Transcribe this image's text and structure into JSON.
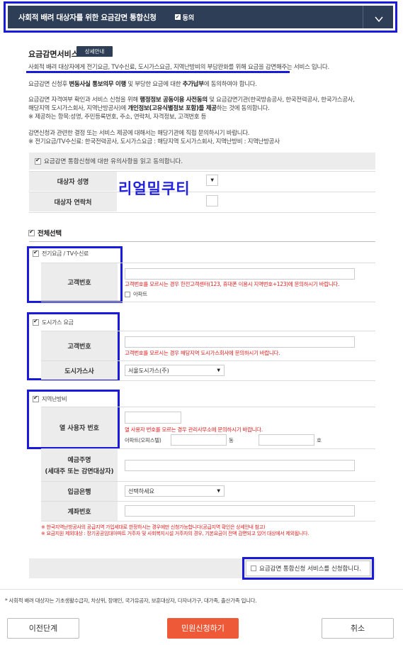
{
  "header": {
    "title": "사회적 배려 대상자를 위한 요금감면 통합신청",
    "agree_label": "동의"
  },
  "service": {
    "title": "요금감면서비스",
    "detail_button": "상세안내",
    "desc1": "사회적 배려 대상자에게 전기요금, TV수신료, 도시가스요금, 지역난방비의 부담완화를 위해 요금을 감면해주는 서비스 입니다.",
    "desc2_pre": "요금감면 신청후 ",
    "desc2_b1": "변동사실 통보의무 이행",
    "desc2_mid": " 및 부당한 요금에 대한 ",
    "desc2_b2": "추가납부",
    "desc2_post": "에 동의하여야 합니다.",
    "desc3_line1_pre": "요금감면 자격여부 확인과 서비스 신청을 위해 ",
    "desc3_line1_b": "행정정보 공동이용 사전동의",
    "desc3_line1_post": " 및 요금감면기관(한국방송공사, 한국전력공사, 한국가스공사,",
    "desc3_line2_pre": "해당지역 도시가스회사, 지역난방공사)에 ",
    "desc3_line2_b": "개인정보(고유식별정보 포함)를 제공",
    "desc3_line2_post": "하는 것에 동의합니다.",
    "desc3_line3": "※ 제공하는 항목:성명, 주민등록번호, 주소, 연락처, 자격정보, 고객번호 등",
    "desc4_line1": "감면신청과 관련한 결정 또는 서비스 제공에 대해서는 해당기관에 직접 문의하시기 바랍니다.",
    "desc4_line2": "※ 전기요금/TV수신료: 한국전력공사, 도시가스요금 : 해당지역 도시가스회사, 지역난방비 : 지역난방공사"
  },
  "consent": {
    "label": "요금감면 통합신청에 대한 유의사항을 읽고 동의합니다."
  },
  "target": {
    "name_label": "대상자 성명",
    "contact_label": "대상자 연락처"
  },
  "watermark": "리얼밀쿠티",
  "select_all_label": "전체선택",
  "electric": {
    "section_label": "전기요금 / TV수신료",
    "customer_no_label": "고객번호",
    "hint": "고객번호를 모르시는 경우 한전고객센터(123, 휴대폰 이용시 지역번호+123)에 문의하시기 바랍니다.",
    "apartment_label": "아파트"
  },
  "gas": {
    "section_label": "도시가스 요금",
    "customer_no_label": "고객번호",
    "hint": "고객번호를 모르시는 경우 해당지역 도시가스회사에 문의하시기 바랍니다.",
    "company_label": "도시가스사",
    "company_value": "서울도시가스(주)"
  },
  "heating": {
    "section_label": "지역난방비",
    "user_no_label": "열 사용자 번호",
    "hint": "열 사용자 번호를 모르는 경우 관리사무소에 문의하시기 바랍니다.",
    "apt_label": "아파트(오피스텔)",
    "dong_label": "동",
    "ho_label": "호",
    "depositor_label_1": "예금주명",
    "depositor_label_2": "(세대주 또는 감면대상자)",
    "bank_label": "입금은행",
    "bank_placeholder": "선택하세요",
    "account_label": "계좌번호",
    "note1": "※ 한국지역난방공사의 공급지역 가입세대로 한정하시는 경우에만 신청가능합니다(공급지역 확인은 상세안내 참고)",
    "note2": "※ 요금지원 제외대상 : 장기공공임대아파트 거주자 및 사회복지시설 거주자의 경우, 기본요금이 전액 감면되고 있어 대상에서 제외됩니다."
  },
  "apply_label": "요금감면 통합신청 서비스를 신청합니다.",
  "footnote": "* 사회적 배려 대상자는 기초생활수급자, 차상위, 장애인, 국가유공자, 보훈대상자, 다자녀가구, 대가족, 출산가족 입니다.",
  "buttons": {
    "prev": "이전단계",
    "submit": "민원신청하기",
    "cancel": "취소"
  },
  "colors": {
    "header_bg": "#2d3e56",
    "highlight_border": "#1a1adc",
    "primary_button": "#ee5a38",
    "hint_red": "#e02020"
  }
}
